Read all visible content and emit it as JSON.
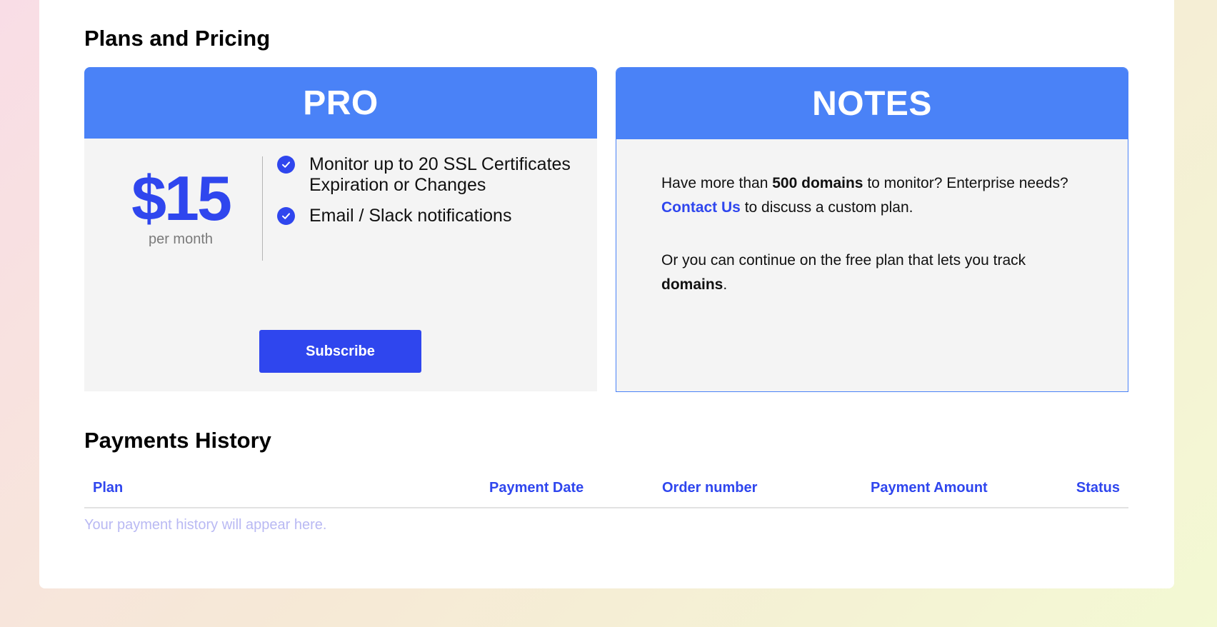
{
  "plans": {
    "title": "Plans and Pricing",
    "pro": {
      "header": "PRO",
      "price": "$15",
      "period": "per month",
      "features": [
        {
          "icon": "check-circle-icon",
          "text": "Monitor up to 20 SSL Certificates Expiration or Changes"
        },
        {
          "icon": "check-circle-icon",
          "text": "Email / Slack notifications"
        }
      ],
      "subscribe_label": "Subscribe"
    },
    "notes": {
      "header": "NOTES",
      "line1_pre": "Have more than ",
      "line1_bold": "500 domains",
      "line1_post": " to monitor? Enterprise needs?",
      "contact_link": "Contact Us",
      "line2_post": " to discuss a custom plan.",
      "line3_pre": "Or you can continue on the free plan that lets you track ",
      "line3_bold": "domains",
      "line3_post": "."
    }
  },
  "payments": {
    "title": "Payments History",
    "columns": [
      "Plan",
      "Payment Date",
      "Order number",
      "Payment Amount",
      "Status"
    ],
    "empty_message": "Your payment history will appear here."
  },
  "colors": {
    "accent": "#2f46ee",
    "header_blue": "#4a82f7",
    "card_bg": "#f4f4f4",
    "empty_text": "#b9b9f3"
  }
}
